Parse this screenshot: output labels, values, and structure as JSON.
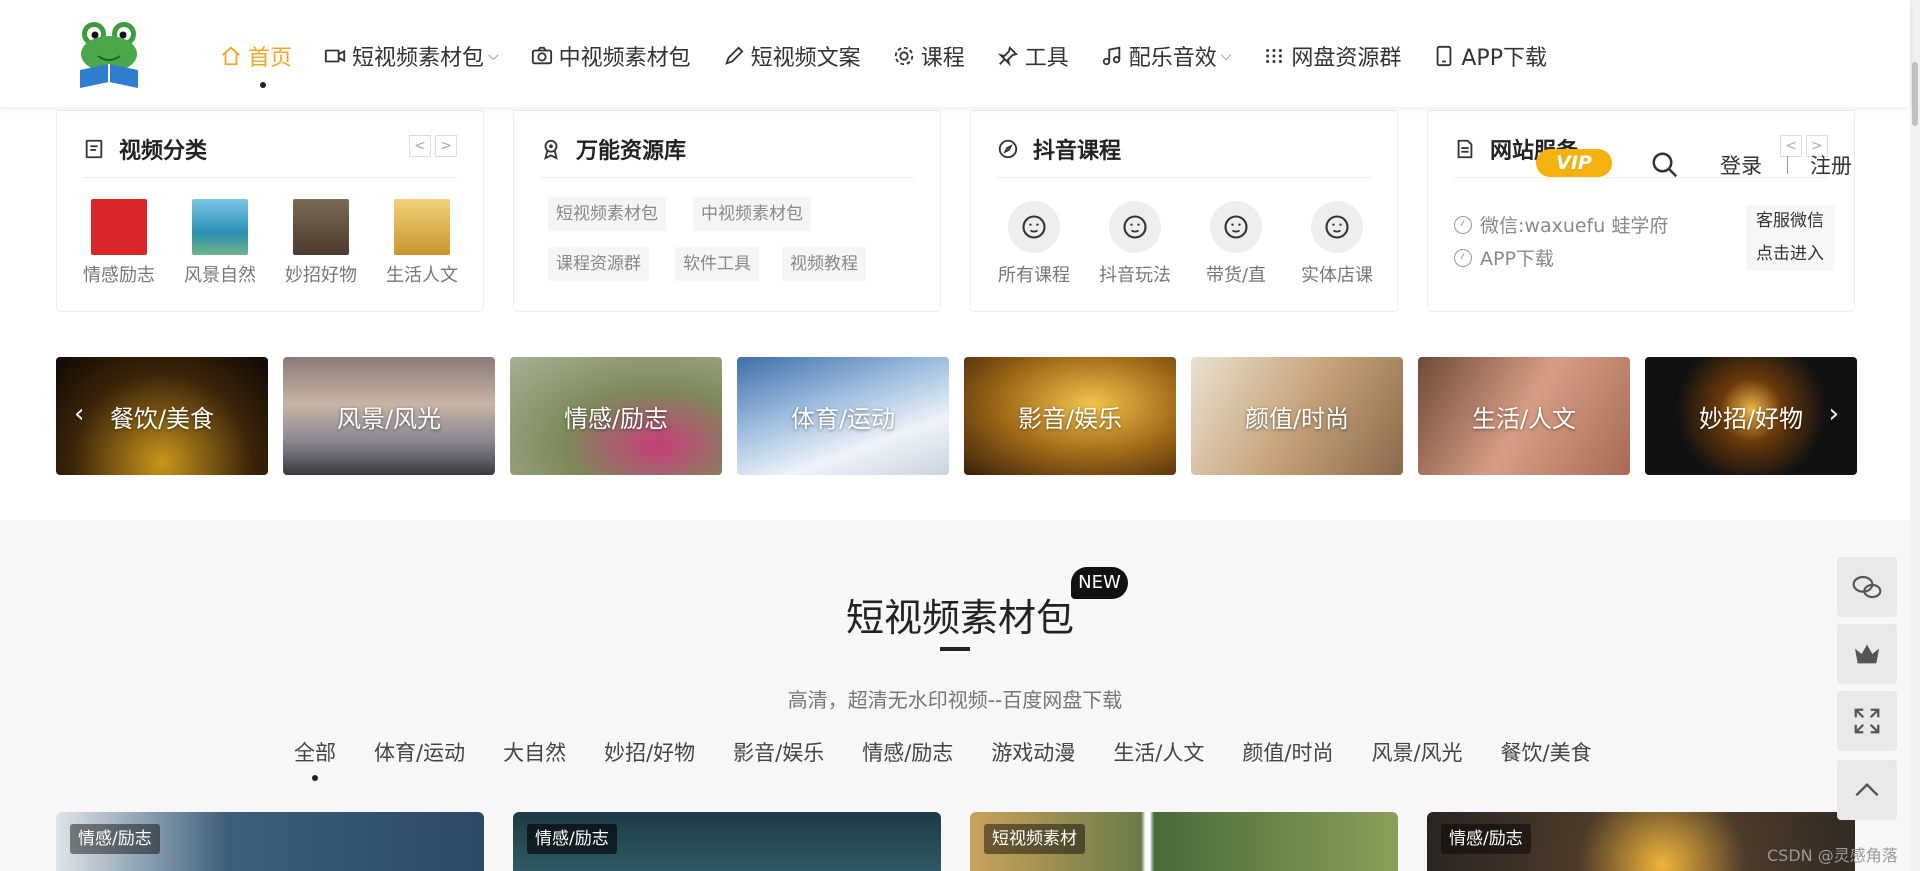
{
  "header": {
    "nav": [
      {
        "label": "首页",
        "icon": "home-icon",
        "active": true
      },
      {
        "label": "短视频素材包",
        "icon": "video-camera-icon",
        "dropdown": true
      },
      {
        "label": "中视频素材包",
        "icon": "camera-icon"
      },
      {
        "label": "短视频文案",
        "icon": "pen-icon"
      },
      {
        "label": "课程",
        "icon": "gear-icon"
      },
      {
        "label": "工具",
        "icon": "pin-icon"
      },
      {
        "label": "配乐音效",
        "icon": "music-icon",
        "dropdown": true
      },
      {
        "label": "网盘资源群",
        "icon": "grid-icon"
      },
      {
        "label": "APP下载",
        "icon": "tablet-icon"
      }
    ],
    "vip_label": "VIP",
    "login_label": "登录",
    "register_label": "注册"
  },
  "cards": {
    "video_category": {
      "title": "视频分类",
      "items": [
        {
          "label": "情感励志",
          "color": "#d9262b"
        },
        {
          "label": "风景自然",
          "color": "#3aa7c7"
        },
        {
          "label": "妙招好物",
          "color": "#5b4a3c"
        },
        {
          "label": "生活人文",
          "color": "#e0b24a"
        }
      ]
    },
    "resource_lib": {
      "title": "万能资源库",
      "tags": [
        "短视频素材包",
        "中视频素材包",
        "课程资源群",
        "软件工具",
        "视频教程"
      ]
    },
    "douyin_course": {
      "title": "抖音课程",
      "items": [
        "所有课程",
        "抖音玩法",
        "带货/直",
        "实体店课"
      ]
    },
    "site_service": {
      "title": "网站服务",
      "lines": [
        "微信:waxuefu 蛙学府",
        "APP下载"
      ],
      "box": [
        "客服微信",
        "点击进入"
      ]
    }
  },
  "banners": [
    {
      "label": "餐饮/美食",
      "color": "#2a1a0a"
    },
    {
      "label": "风景/风光",
      "color": "#9a8b86"
    },
    {
      "label": "情感/励志",
      "color": "#7d8a5a"
    },
    {
      "label": "体育/运动",
      "color": "#5a86b8"
    },
    {
      "label": "影音/娱乐",
      "color": "#a06a18"
    },
    {
      "label": "颜值/时尚",
      "color": "#c7a37a"
    },
    {
      "label": "生活/人文",
      "color": "#b97864"
    },
    {
      "label": "妙招/好物",
      "color": "#1a1a1a"
    }
  ],
  "section": {
    "title": "短视频素材包",
    "badge": "NEW",
    "subtitle": "高清，超清无水印视频--百度网盘下载",
    "tabs": [
      "全部",
      "体育/运动",
      "大自然",
      "妙招/好物",
      "影音/娱乐",
      "情感/励志",
      "游戏动漫",
      "生活/人文",
      "颜值/时尚",
      "风景/风光",
      "餐饮/美食"
    ],
    "cards": [
      {
        "label": "情感/励志",
        "color": "#3e5f7a"
      },
      {
        "label": "情感/励志",
        "color": "#23414a"
      },
      {
        "label": "短视频素材",
        "color": "#6a7a4a"
      },
      {
        "label": "情感/励志",
        "color": "#4a3a2a"
      }
    ]
  },
  "sidebar": [
    "wechat-icon",
    "crown-icon",
    "fullscreen-icon",
    "back-to-top-icon"
  ],
  "watermark": "CSDN @灵感角落"
}
